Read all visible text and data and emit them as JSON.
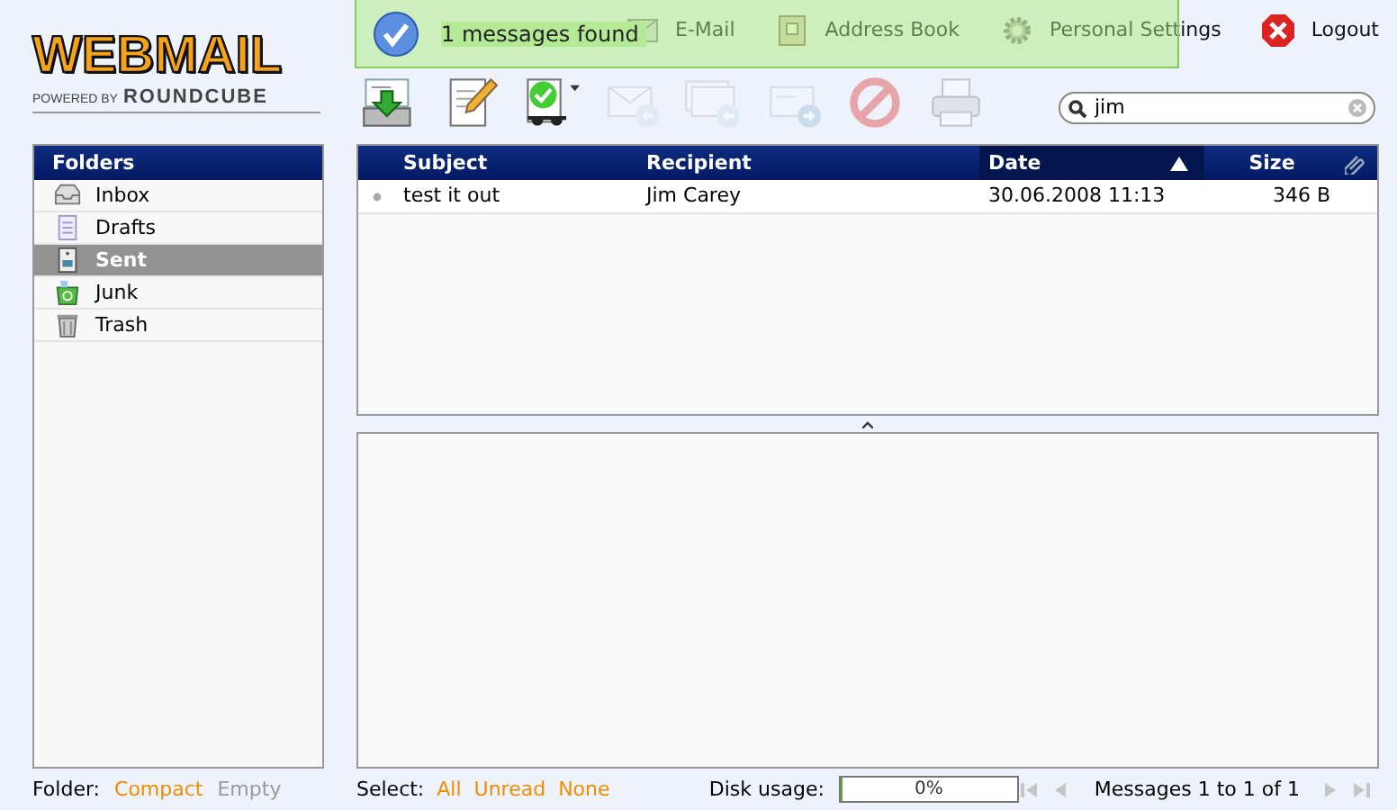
{
  "logo": {
    "title": "WEBMAIL",
    "tagline_prefix": "POWERED BY",
    "tagline_brand": "ROUNDCUBE"
  },
  "nav": [
    {
      "kind": "email",
      "label": "E-Mail"
    },
    {
      "kind": "addressbook",
      "label": "Address Book"
    },
    {
      "kind": "settings",
      "label": "Personal Settings"
    },
    {
      "kind": "logout",
      "label": "Logout"
    }
  ],
  "notification": {
    "text": "1 messages found"
  },
  "toolbar": [
    {
      "kind": "get-mail",
      "disabled": false
    },
    {
      "kind": "compose",
      "disabled": false
    },
    {
      "kind": "mark",
      "disabled": false
    },
    {
      "kind": "reply",
      "disabled": true
    },
    {
      "kind": "reply-all",
      "disabled": true
    },
    {
      "kind": "forward",
      "disabled": true
    },
    {
      "kind": "delete",
      "disabled": true
    },
    {
      "kind": "print",
      "disabled": true
    }
  ],
  "search": {
    "value": "jim"
  },
  "folders": {
    "title": "Folders",
    "items": [
      {
        "kind": "inbox",
        "name": "Inbox",
        "selected": false
      },
      {
        "kind": "drafts",
        "name": "Drafts",
        "selected": false
      },
      {
        "kind": "sent",
        "name": "Sent",
        "selected": true
      },
      {
        "kind": "junk",
        "name": "Junk",
        "selected": false
      },
      {
        "kind": "trash",
        "name": "Trash",
        "selected": false
      }
    ]
  },
  "message_list": {
    "columns": [
      {
        "label": "Subject",
        "sorted": false
      },
      {
        "label": "Recipient",
        "sorted": false
      },
      {
        "label": "Date",
        "sorted": true
      },
      {
        "label": "Size",
        "sorted": false
      }
    ],
    "rows": [
      {
        "subject": "test it out",
        "recipient": "Jim Carey",
        "date": "30.06.2008 11:13",
        "size": "346 B"
      }
    ]
  },
  "footer": {
    "folder_label": "Folder:",
    "folder_actions": [
      {
        "label": "Compact",
        "disabled": false
      },
      {
        "label": "Empty",
        "disabled": true
      }
    ],
    "select_label": "Select:",
    "select_actions": [
      {
        "label": "All",
        "disabled": false
      },
      {
        "label": "Unread",
        "disabled": false
      },
      {
        "label": "None",
        "disabled": false
      }
    ],
    "disk_label": "Disk usage:",
    "disk": {
      "level": 0,
      "reading": "0%"
    },
    "pager_back": [
      {
        "kind": "first",
        "disabled": true
      },
      {
        "kind": "prev",
        "disabled": true
      }
    ],
    "pager_text": "Messages 1 to 1 of 1",
    "pager_forward": [
      {
        "kind": "next",
        "disabled": true
      },
      {
        "kind": "last",
        "disabled": true
      }
    ]
  }
}
